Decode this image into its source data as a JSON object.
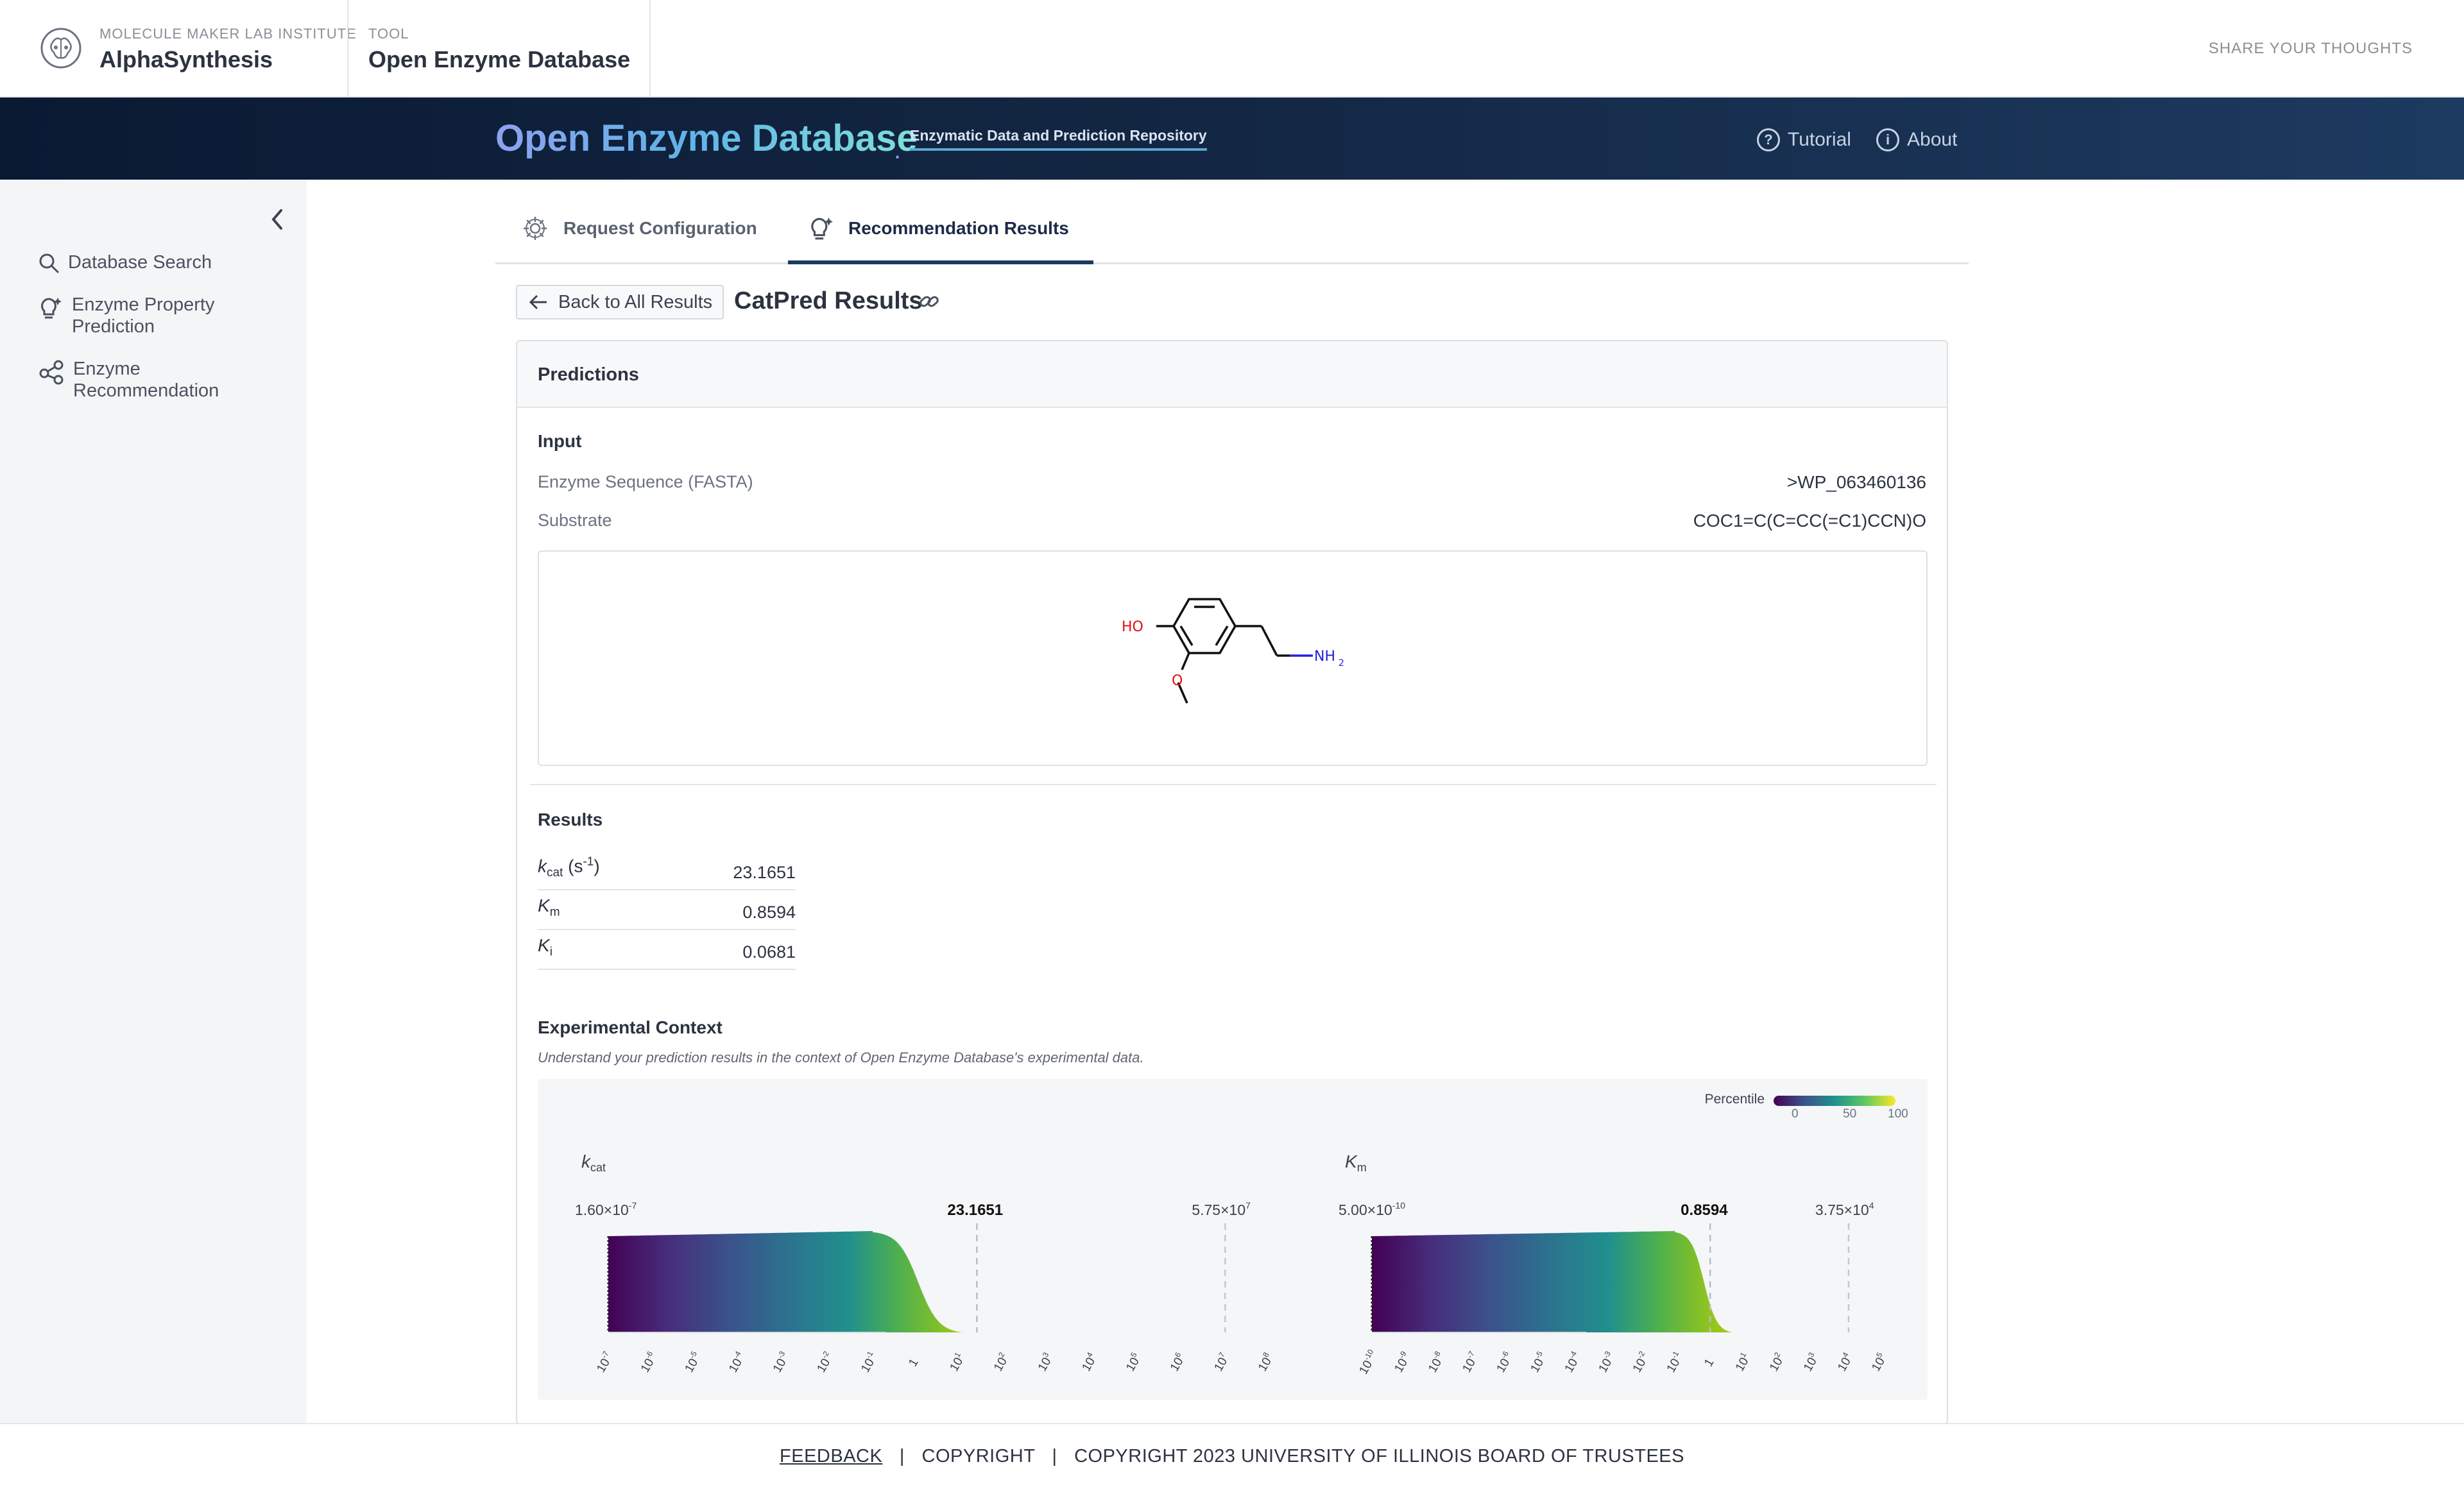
{
  "topbar": {
    "org_small": "MOLECULE MAKER LAB INSTITUTE",
    "org_name": "AlphaSynthesis",
    "tool_small": "TOOL",
    "tool_name": "Open Enzyme Database",
    "share": "SHARE YOUR THOUGHTS"
  },
  "banner": {
    "title": "Open Enzyme Database",
    "subtitle": "Enzymatic Data and Prediction Repository",
    "nav": [
      {
        "label": "Tutorial",
        "icon": "question-circle-icon"
      },
      {
        "label": "About",
        "icon": "info-circle-icon"
      }
    ]
  },
  "sidebar": {
    "items": [
      {
        "label": "Database Search",
        "icon": "search-icon"
      },
      {
        "label_line1": "Enzyme Property",
        "label_line2": "Prediction",
        "icon": "lightbulb-icon"
      },
      {
        "label_line1": "Enzyme",
        "label_line2": "Recommendation",
        "icon": "share-nodes-icon"
      }
    ]
  },
  "tabs": [
    {
      "label": "Request Configuration",
      "active": false
    },
    {
      "label": "Recommendation Results",
      "active": true
    }
  ],
  "header": {
    "back_label": "Back to All Results",
    "title": "CatPred Results"
  },
  "card": {
    "title": "Predictions",
    "input_label": "Input",
    "fields": [
      {
        "key": "Enzyme Sequence (FASTA)",
        "value": ">WP_063460136"
      },
      {
        "key": "Substrate",
        "value": "COC1=C(C=CC(=C1)CCN)O"
      }
    ],
    "molecule_labels": {
      "ho": "HO",
      "o": "O",
      "nh": "NH",
      "nh_sub": "2"
    },
    "results_label": "Results",
    "results": [
      {
        "symbol": "k",
        "sub": "cat",
        "unit": "(s",
        "unit_sup": "-1",
        "unit_close": ")",
        "value": "23.1651"
      },
      {
        "symbol": "K",
        "sub": "m",
        "value": "0.8594"
      },
      {
        "symbol": "K",
        "sub": "i",
        "value": "0.0681"
      }
    ],
    "context_label": "Experimental Context",
    "context_desc": "Understand your prediction results in the context of Open Enzyme Database's experimental data."
  },
  "legend": {
    "title": "Percentile",
    "ticks": [
      "0",
      "50",
      "100"
    ]
  },
  "chart_data": [
    {
      "type": "area",
      "title_symbol": "k",
      "title_sub": "cat",
      "min_label": "1.60×10",
      "min_sup": "-7",
      "max_label": "5.75×10",
      "max_sup": "7",
      "marker_value": 23.1651,
      "marker_label": "23.1651",
      "x_scale": "log",
      "xlim_exp": [
        -7,
        8
      ],
      "tick_labels": [
        "10-7",
        "10-6",
        "10-5",
        "10-4",
        "10-3",
        "10-2",
        "10-1",
        "1",
        "101",
        "102",
        "103",
        "104",
        "105",
        "106",
        "107",
        "108"
      ],
      "tick_exps": [
        -7,
        -6,
        -5,
        -4,
        -3,
        -2,
        -1,
        0,
        1,
        2,
        3,
        4,
        5,
        6,
        7,
        8
      ],
      "density_shape": {
        "flat_until_exp": -1.0,
        "falloff_to_exp": 1.3
      }
    },
    {
      "type": "area",
      "title_symbol": "K",
      "title_sub": "m",
      "min_label": "5.00×10",
      "min_sup": "-10",
      "max_label": "3.75×10",
      "max_sup": "4",
      "marker_value": 0.8594,
      "marker_label": "0.8594",
      "x_scale": "log",
      "xlim_exp": [
        -10,
        5
      ],
      "tick_labels": [
        "10-10",
        "10-9",
        "10-8",
        "10-7",
        "10-6",
        "10-5",
        "10-4",
        "10-3",
        "10-2",
        "10-1",
        "1",
        "101",
        "102",
        "103",
        "104",
        "105"
      ],
      "tick_exps": [
        -10,
        -9,
        -8,
        -7,
        -6,
        -5,
        -4,
        -3,
        -2,
        -1,
        0,
        1,
        2,
        3,
        4,
        5
      ],
      "density_shape": {
        "flat_until_exp": -1.1,
        "falloff_to_exp": 0.8
      }
    }
  ],
  "footer": {
    "feedback": "FEEDBACK",
    "copyright": "COPYRIGHT",
    "copyright_full": "COPYRIGHT 2023 UNIVERSITY OF ILLINOIS BOARD OF TRUSTEES"
  },
  "colors": {
    "banner": "#132744",
    "accent": "#1d3a60",
    "viridis": [
      "#440154",
      "#3b528b",
      "#21908d",
      "#5dc863",
      "#fde725"
    ]
  }
}
